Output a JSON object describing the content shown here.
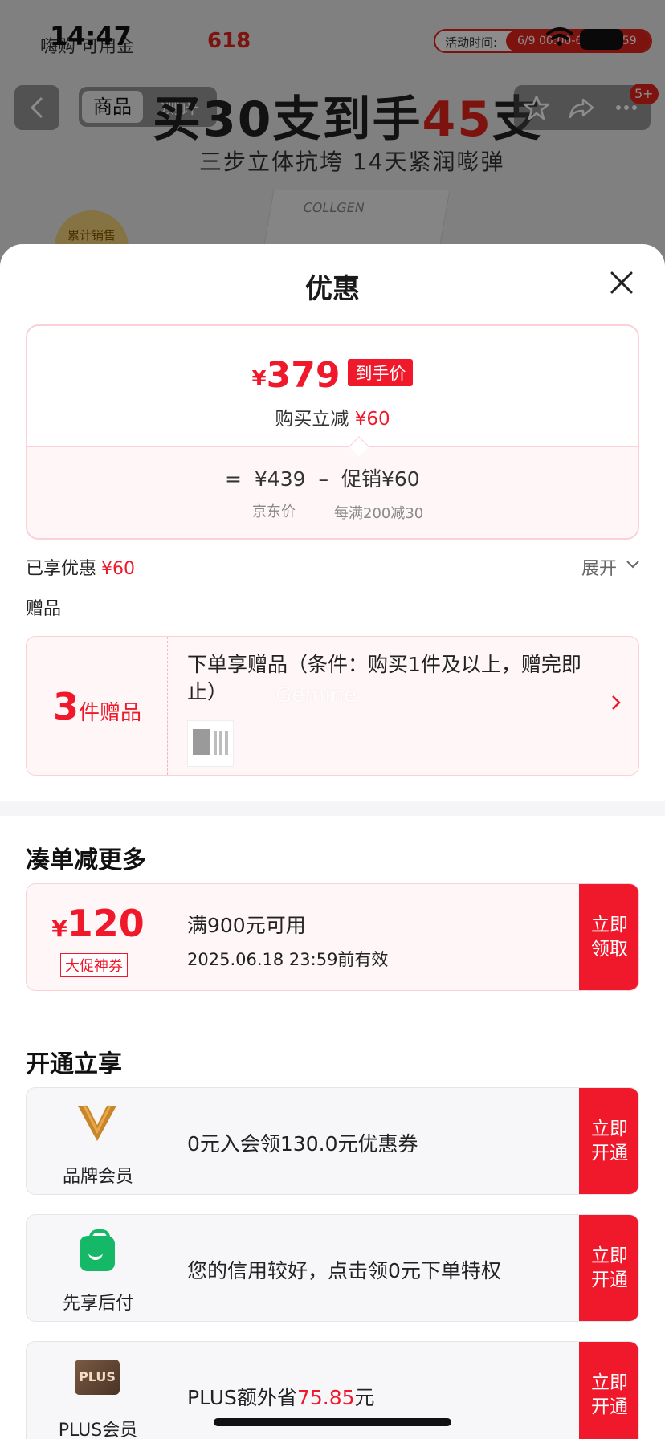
{
  "background": {
    "status": {
      "time": "14:47",
      "activity_label": "活动时间:",
      "activity_time": "6/9 00:00-6/18 23:59"
    },
    "promo_small": "嗨购 可用金",
    "promo_618": "618",
    "tabs": [
      "商品",
      "测评"
    ],
    "headline_a": "买30支到手",
    "headline_b": "45",
    "headline_c": "支",
    "subhead": "三步立体抗垮 14天紧润嘭弹",
    "sales_badge": "累计销售",
    "product_text": "COLLGEN",
    "notification_badge": "5+"
  },
  "sheet": {
    "title": "优惠",
    "price": {
      "yen": "¥",
      "final": "379",
      "tag": "到手价",
      "sub_label": "购买立减",
      "sub_value": "¥60",
      "eq": "=",
      "jd_price": "¥439",
      "minus": "–",
      "promo": "促销¥60",
      "jd_caption": "京东价",
      "promo_caption": "每满200减30"
    },
    "enjoyed_label": "已享优惠",
    "enjoyed_value": "¥60",
    "expand_label": "展开",
    "gift_section": "赠品",
    "gift": {
      "count": "3",
      "unit": "件赠品",
      "desc": "下单享赠品（条件：购买1件及以上，赠完即止）",
      "watermark": "Gemine"
    },
    "more_title": "凑单减更多",
    "coupon": {
      "yen": "¥",
      "amount": "120",
      "tag": "大促神券",
      "condition": "满900元可用",
      "valid": "2025.06.18 23:59前有效",
      "button": "立即领取"
    },
    "open_title": "开通立享",
    "members": [
      {
        "name": "品牌会员",
        "text": "0元入会领130.0元优惠券",
        "button": "立即开通"
      },
      {
        "name": "先享后付",
        "text": "您的信用较好，点击领0元下单特权",
        "button": "立即开通"
      },
      {
        "name": "PLUS会员",
        "logo_text": "PLUS",
        "text_a": "PLUS额外省",
        "text_b": "75.85",
        "text_c": "元",
        "button": "立即开通"
      }
    ]
  },
  "colors": {
    "accent": "#f0192b",
    "card_pink": "#fff6f7",
    "border_pink": "#fbd0d6",
    "member_gray": "#f7f7f9",
    "bag_green": "#14b866",
    "v_gold": "#c8862a"
  },
  "icons": [
    "back-arrow-icon",
    "star-icon",
    "share-icon",
    "more-icon",
    "close-icon",
    "chevron-down-icon",
    "chevron-right-icon",
    "wifi-icon",
    "battery-icon",
    "location-arrow-icon"
  ]
}
